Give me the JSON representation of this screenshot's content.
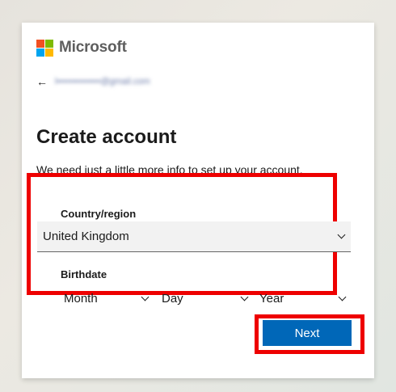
{
  "brand": {
    "name": "Microsoft",
    "logo_colors": [
      "#f25022",
      "#7fba00",
      "#00a4ef",
      "#ffb900"
    ]
  },
  "back": {
    "email": "l••••••••••••••@gmail.com"
  },
  "page": {
    "title": "Create account",
    "description": "We need just a little more info to set up your account."
  },
  "form": {
    "country_label": "Country/region",
    "country_value": "United Kingdom",
    "birthdate_label": "Birthdate",
    "month_value": "Month",
    "day_value": "Day",
    "year_value": "Year"
  },
  "actions": {
    "next_label": "Next"
  },
  "highlight_color": "#ee0000",
  "accent_color": "#0067b8"
}
